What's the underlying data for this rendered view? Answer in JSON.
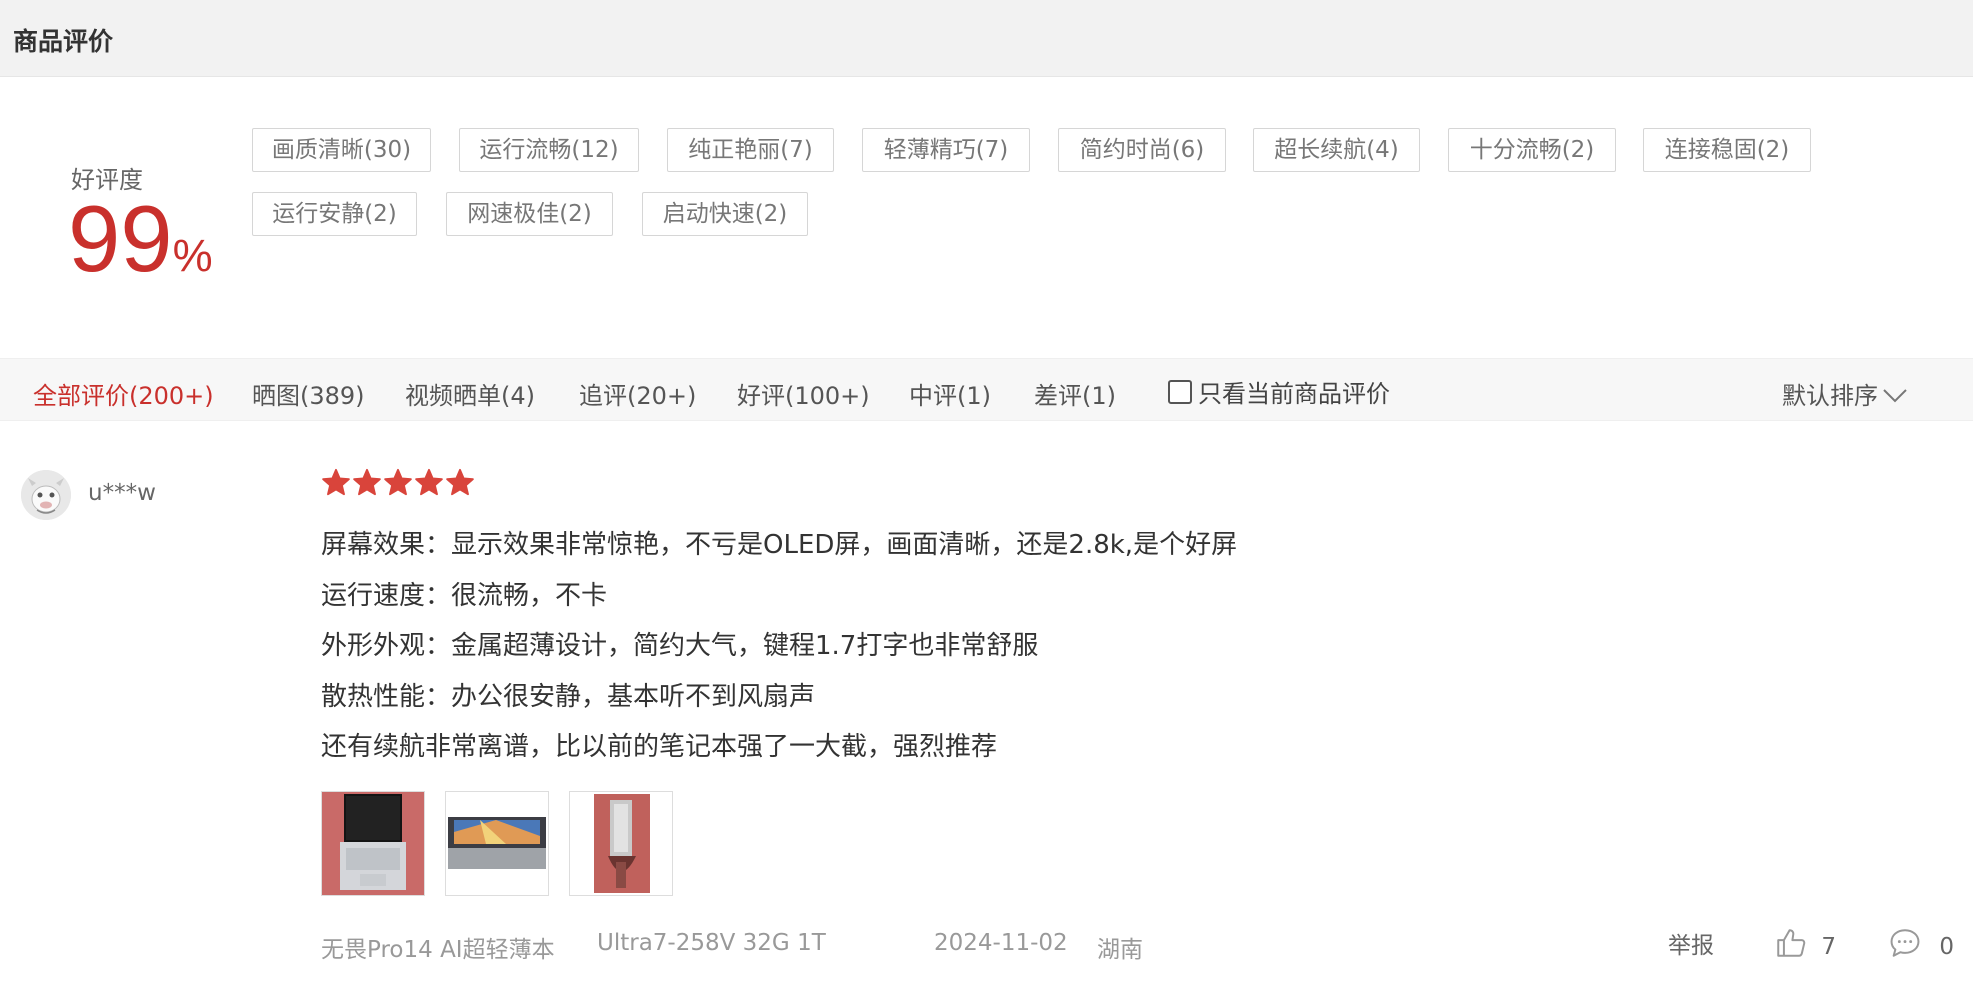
{
  "header": {
    "title": "商品评价"
  },
  "rating": {
    "label": "好评度",
    "value": "99",
    "unit": "%"
  },
  "accent_color": "#c9302c",
  "tags": [
    "画质清晰(30)",
    "运行流畅(12)",
    "纯正艳丽(7)",
    "轻薄精巧(7)",
    "简约时尚(6)",
    "超长续航(4)",
    "十分流畅(2)",
    "连接稳固(2)",
    "运行安静(2)",
    "网速极佳(2)",
    "启动快速(2)"
  ],
  "filters": {
    "tabs": [
      "全部评价(200+)",
      "晒图(389)",
      "视频晒单(4)",
      "追评(20+)",
      "好评(100+)",
      "中评(1)",
      "差评(1)"
    ],
    "active_tab": 0,
    "only_current_label": "只看当前商品评价",
    "only_current_checked": false,
    "sort_label": "默认排序",
    "sort_icon": "chevron-down-icon"
  },
  "review": {
    "username": "u***w",
    "avatar_icon": "cartoon-cow-avatar",
    "stars": 5,
    "lines": [
      "屏幕效果：显示效果非常惊艳，不亏是OLED屏，画面清晰，还是2.8k,是个好屏",
      "运行速度：很流畅，不卡",
      "外形外观：金属超薄设计，简约大气，键程1.7打字也非常舒服",
      "散热性能：办公很安静，基本听不到风扇声",
      "还有续航非常离谱，比以前的笔记本强了一大截，强烈推荐"
    ],
    "product": "无畏Pro14 AI超轻薄本",
    "spec": "Ultra7-258V 32G 1T",
    "date": "2024-11-02",
    "location": "湖南",
    "report_label": "举报",
    "likes": "7",
    "comments": "0"
  }
}
